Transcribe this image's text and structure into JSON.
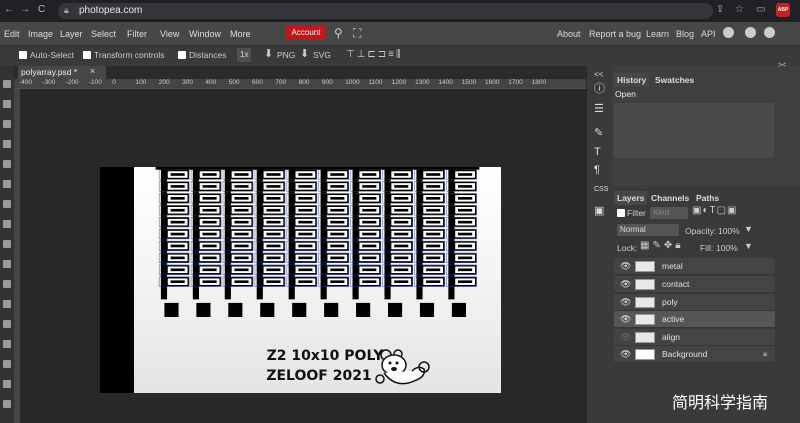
{
  "browser": {
    "back": "←",
    "forward": "→",
    "reload": "C",
    "url": "photopea.com",
    "ext_badge": "ABP"
  },
  "menubar": {
    "items": [
      "Edit",
      "Image",
      "Layer",
      "Select",
      "Filter",
      "View",
      "Window",
      "More"
    ],
    "account": "Account",
    "right_links": [
      "About",
      "Report a bug",
      "Learn",
      "Blog",
      "API"
    ]
  },
  "options": {
    "auto_select": "Auto-Select",
    "transform_controls": "Transform controls",
    "distances": "Distances",
    "scale": "1x",
    "png": "PNG",
    "svg": "SVG"
  },
  "document": {
    "tab_name": "polyarray.psd *",
    "close": "×",
    "ruler_ticks": [
      "-400",
      "-300",
      "-200",
      "-100",
      "0",
      "100",
      "200",
      "300",
      "400",
      "500",
      "600",
      "700",
      "800",
      "900",
      "1000",
      "1100",
      "1200",
      "1300",
      "1400",
      "1500",
      "1600",
      "1700",
      "1800"
    ]
  },
  "canvas": {
    "line1": "Z2 10x10 POLY",
    "line2": "ZELOOF 2021"
  },
  "history_panel": {
    "tabs": [
      "History",
      "Swatches"
    ],
    "items": [
      "Open"
    ]
  },
  "layers_panel": {
    "tabs": [
      "Layers",
      "Channels",
      "Paths"
    ],
    "filter_label": "Filter",
    "kind": "Kind",
    "blend_mode": "Normal",
    "opacity_label": "Opacity:",
    "opacity_value": "100%",
    "lock_label": "Lock:",
    "fill_label": "Fill:",
    "fill_value": "100%",
    "layers": [
      {
        "name": "metal"
      },
      {
        "name": "contact"
      },
      {
        "name": "poly"
      },
      {
        "name": "active"
      },
      {
        "name": "align"
      },
      {
        "name": "Background"
      }
    ]
  },
  "watermark": "简明科学指南"
}
